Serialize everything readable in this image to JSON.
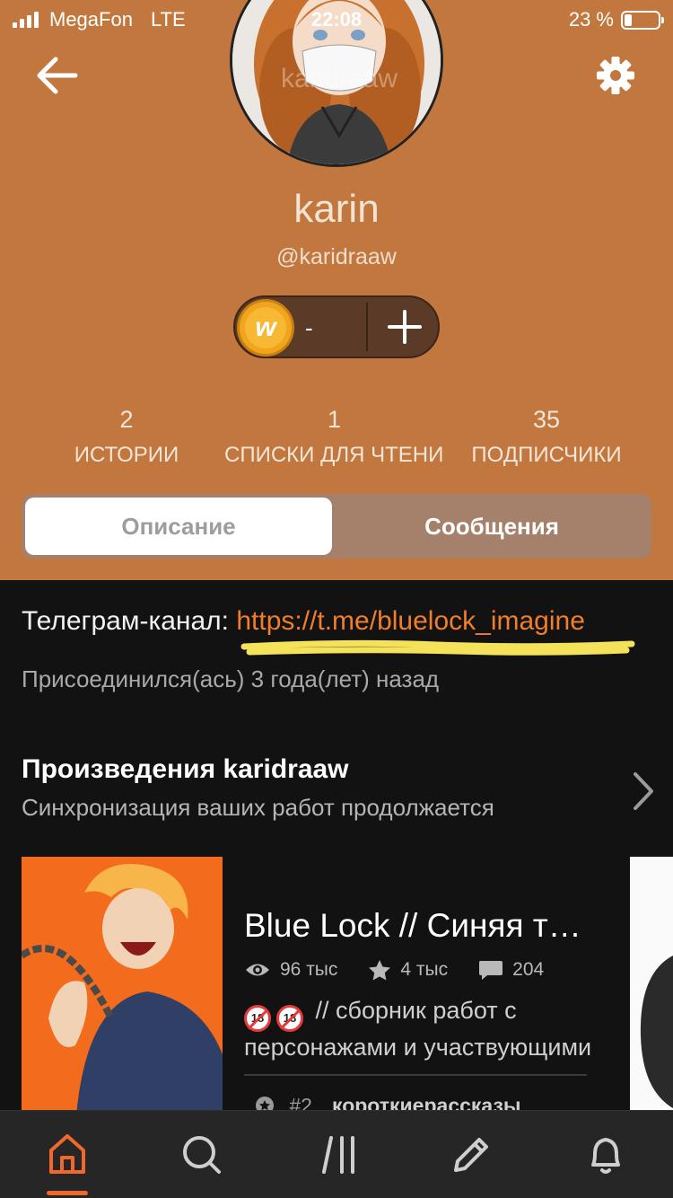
{
  "status_bar": {
    "carrier": "MegaFon",
    "network": "LTE",
    "time": "22:08",
    "battery": "23 %",
    "battery_level": 0.23
  },
  "profile": {
    "display_name": "karin",
    "username": "@karidraaw",
    "avatar_watermark": "karidraaw",
    "coins": {
      "icon_letter": "w",
      "value": "-",
      "plus_label": "+"
    },
    "stats": [
      {
        "value": "2",
        "label": "ИСТОРИИ"
      },
      {
        "value": "1",
        "label": "СПИСКИ ДЛЯ ЧТЕНИЯ"
      },
      {
        "value": "35",
        "label": "ПОДПИСЧИКИ"
      }
    ],
    "tabs": [
      {
        "label": "Описание",
        "active": true
      },
      {
        "label": "Сообщения",
        "active": false
      }
    ]
  },
  "about": {
    "description_prefix": "Телеграм-канал: ",
    "description_link": "https://t.me/bluelock_imagine",
    "joined": "Присоединился(ась) 3 года(лет) назад"
  },
  "works": {
    "title_prefix": "Произведения",
    "title_user": "karidraaw",
    "subtitle": "Синхронизация ваших работ продолжается",
    "story": {
      "title": "Blue Lock // Синяя тюрьма",
      "reads": "96 тыс",
      "votes": "4 тыс",
      "parts": "204",
      "description_line1": "// сборник работ с",
      "description_line2": "персонажами и участвующими",
      "rank": "#2",
      "tag": "короткиерассказы"
    }
  },
  "colors": {
    "header_bg": "#c1773e",
    "accent": "#f07e2a",
    "body_bg": "#121212",
    "nav_bg": "#262626"
  },
  "nav": {
    "items": [
      "home-icon",
      "search-icon",
      "library-icon",
      "write-icon",
      "bell-icon"
    ],
    "active": "home-icon"
  }
}
